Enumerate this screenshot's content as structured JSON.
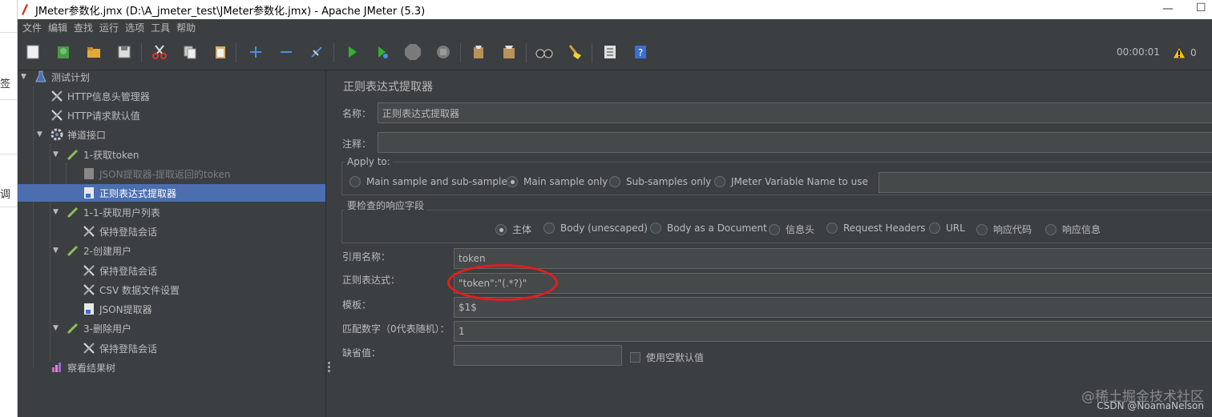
{
  "window": {
    "title": "JMeter参数化.jmx (D:\\A_jmeter_test\\JMeter参数化.jmx) - Apache JMeter (5.3)"
  },
  "left_strip": {
    "chars": [
      "签",
      "调"
    ]
  },
  "menu": [
    "文件",
    "编辑",
    "查找",
    "运行",
    "选项",
    "工具",
    "帮助"
  ],
  "toolbar": {
    "timer": "00:00:01",
    "warning_count": "0"
  },
  "tree": {
    "nodes": [
      {
        "label": "测试计划"
      },
      {
        "label": "HTTP信息头管理器"
      },
      {
        "label": "HTTP请求默认值"
      },
      {
        "label": "禅道接口"
      },
      {
        "label": "1-获取token"
      },
      {
        "label": "JSON提取器-提取返回的token"
      },
      {
        "label": "正则表达式提取器"
      },
      {
        "label": "1-1-获取用户列表"
      },
      {
        "label": "保持登陆会话"
      },
      {
        "label": "2-创建用户"
      },
      {
        "label": "保持登陆会话"
      },
      {
        "label": "CSV 数据文件设置"
      },
      {
        "label": "JSON提取器"
      },
      {
        "label": "3-删除用户"
      },
      {
        "label": "保持登陆会话"
      },
      {
        "label": "察看结果树"
      }
    ]
  },
  "panel": {
    "title": "正则表达式提取器",
    "name_label": "名称：",
    "name_value": "正则表达式提取器",
    "comment_label": "注释：",
    "comment_value": "",
    "apply_to": {
      "title": "Apply to:",
      "options": [
        "Main sample and sub-samples",
        "Main sample only",
        "Sub-samples only",
        "JMeter Variable Name to use"
      ],
      "selected": 1
    },
    "response_field": {
      "title": "要检查的响应字段",
      "options": [
        "主体",
        "Body (unescaped)",
        "Body as a Document",
        "信息头",
        "Request Headers",
        "URL",
        "响应代码",
        "响应信息"
      ],
      "selected": 0
    },
    "ref_name_label": "引用名称：",
    "ref_name_value": "token",
    "regex_label": "正则表达式：",
    "regex_value": "\"token\":\"(.*?)\"",
    "template_label": "模板：",
    "template_value": "$1$",
    "match_no_label": "匹配数字（0代表随机）：",
    "match_no_value": "1",
    "default_label": "缺省值：",
    "default_value": "",
    "use_empty_label": "使用空默认值"
  },
  "watermark": {
    "line1": "@稀土掘金技术社区",
    "line2": "CSDN @NoamaNelson"
  },
  "colors": {
    "background": "#3c3f41",
    "selection": "#4b6eaf",
    "highlight": "#e51d1d"
  }
}
